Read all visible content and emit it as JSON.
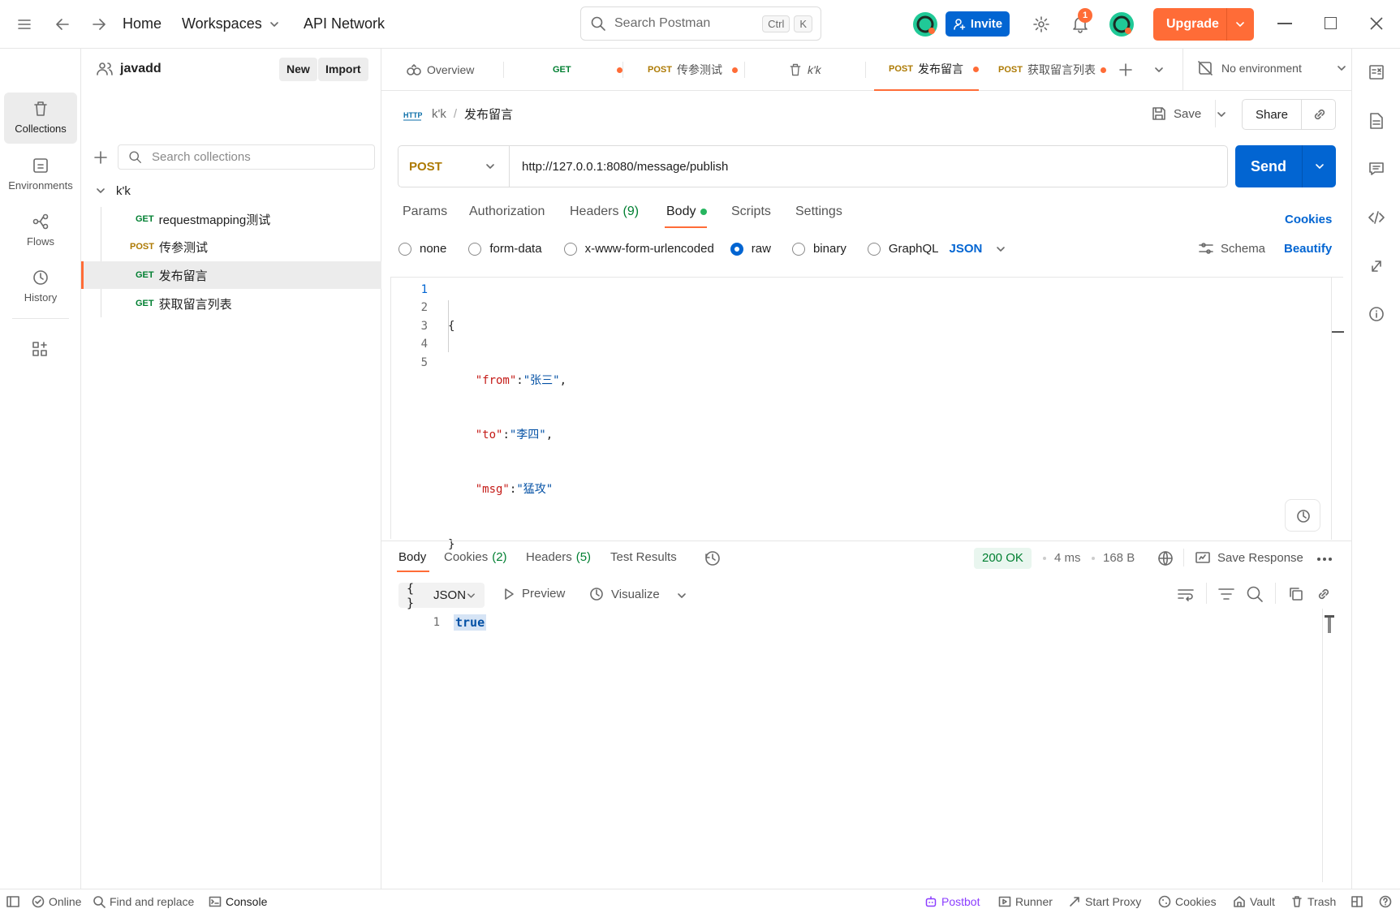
{
  "topbar": {
    "home": "Home",
    "workspaces": "Workspaces",
    "api_network": "API Network",
    "search_placeholder": "Search Postman",
    "kbd_ctrl": "Ctrl",
    "kbd_k": "K",
    "invite": "Invite",
    "notifications_count": "1",
    "upgrade": "Upgrade"
  },
  "rail": {
    "collections": "Collections",
    "environments": "Environments",
    "flows": "Flows",
    "history": "History"
  },
  "sidebar": {
    "workspace_name": "javadd",
    "new_label": "New",
    "import_label": "Import",
    "search_placeholder": "Search collections",
    "collection_name": "k'k",
    "items": [
      {
        "method": "GET",
        "name": "requestmapping测试"
      },
      {
        "method": "POST",
        "name": "传参测试"
      },
      {
        "method": "GET",
        "name": "发布留言"
      },
      {
        "method": "GET",
        "name": "获取留言列表"
      }
    ]
  },
  "tabs": [
    {
      "method": "",
      "label": "Overview"
    },
    {
      "method": "GET",
      "label": ""
    },
    {
      "method": "POST",
      "label": "传参测试"
    },
    {
      "method": "",
      "label": "k'k"
    },
    {
      "method": "POST",
      "label": "发布留言"
    },
    {
      "method": "POST",
      "label": "获取留言列表"
    }
  ],
  "environment": "No environment",
  "request": {
    "breadcrumb_collection": "k'k",
    "breadcrumb_sep": "/",
    "breadcrumb_name": "发布留言",
    "save_label": "Save",
    "share_label": "Share",
    "method": "POST",
    "url": "http://127.0.0.1:8080/message/publish",
    "send_label": "Send",
    "subtabs": {
      "params": "Params",
      "authorization": "Authorization",
      "headers": "Headers",
      "headers_count": "(9)",
      "body": "Body",
      "scripts": "Scripts",
      "settings": "Settings"
    },
    "cookies_link": "Cookies",
    "body_types": {
      "none": "none",
      "form_data": "form-data",
      "urlencoded": "x-www-form-urlencoded",
      "raw": "raw",
      "binary": "binary",
      "graphql": "GraphQL"
    },
    "body_format": "JSON",
    "schema_label": "Schema",
    "beautify_label": "Beautify",
    "code": {
      "l1": "1",
      "l2": "2",
      "l3": "3",
      "l4": "4",
      "l5": "5",
      "open": "{",
      "k_from": "\"from\"",
      "v_from": "\"张三\"",
      "k_to": "\"to\"",
      "v_to": "\"李四\"",
      "k_msg": "\"msg\"",
      "v_msg": "\"猛攻\"",
      "close": "}",
      "colon": ":",
      "comma": ","
    }
  },
  "response": {
    "tabs": {
      "body": "Body",
      "cookies": "Cookies",
      "cookies_count": "(2)",
      "headers": "Headers",
      "headers_count": "(5)",
      "test_results": "Test Results"
    },
    "status": "200 OK",
    "time": "4 ms",
    "size": "168 B",
    "save_response": "Save Response",
    "format": "JSON",
    "preview": "Preview",
    "visualize": "Visualize",
    "line_no": "1",
    "body_value": "true"
  },
  "statusbar": {
    "online": "Online",
    "find_replace": "Find and replace",
    "console": "Console",
    "postbot": "Postbot",
    "runner": "Runner",
    "start_proxy": "Start Proxy",
    "cookies": "Cookies",
    "vault": "Vault",
    "trash": "Trash"
  },
  "colors": {
    "accent_orange": "#ff6c37",
    "primary_blue": "#0265d2",
    "get_green": "#007f31",
    "post_gold": "#ad7a03"
  }
}
